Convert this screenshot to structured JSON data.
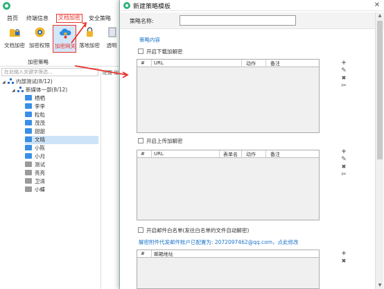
{
  "app": {
    "menu": [
      {
        "label": "首页"
      },
      {
        "label": "终端信息"
      },
      {
        "label": "文档加密"
      },
      {
        "label": "安全策略"
      }
    ],
    "ribbon": [
      {
        "label": "文档加密",
        "icon": "folder-lock-icon"
      },
      {
        "label": "加密权限",
        "icon": "gear-shield-icon"
      },
      {
        "label": "加密网关",
        "icon": "cloud-lock-icon"
      },
      {
        "label": "落地加密",
        "icon": "lock-icon"
      },
      {
        "label": "透明",
        "icon": "doc-icon"
      }
    ],
    "ribbon_group": "加密策略",
    "search_placeholder": "在此输入关键字筛选...",
    "right_tab": "配置 加",
    "tree": [
      {
        "label": "内部测试(8/12)",
        "type": "group"
      },
      {
        "label": "新媒体一部(8/12)",
        "type": "group"
      },
      {
        "label": "栖栖",
        "type": "pc"
      },
      {
        "label": "李李",
        "type": "pc"
      },
      {
        "label": "粒粒",
        "type": "pc"
      },
      {
        "label": "茂茂",
        "type": "pc"
      },
      {
        "label": "甜甜",
        "type": "pc"
      },
      {
        "label": "文晴",
        "type": "pc"
      },
      {
        "label": "小陈",
        "type": "pc"
      },
      {
        "label": "小月",
        "type": "pc"
      },
      {
        "label": "测试",
        "type": "pc"
      },
      {
        "label": "亮亮",
        "type": "pc"
      },
      {
        "label": "卫清",
        "type": "pc"
      },
      {
        "label": "小蝶",
        "type": "pc"
      }
    ]
  },
  "dialog": {
    "title": "新建策略模板",
    "close": "✕",
    "name_label": "策略名称:",
    "name_value": "",
    "content_heading": "策略内容",
    "download": {
      "check_label": "开启下载加解密",
      "columns": [
        "#",
        "URL",
        "动作",
        "备注"
      ]
    },
    "upload": {
      "check_label": "开启上传加解密",
      "columns": [
        "#",
        "URL",
        "表单名",
        "动作",
        "备注"
      ]
    },
    "mail": {
      "check_label": "开启邮件白名单(发往白名单的文件自动解密)",
      "note": "解密附件代发邮件账户已配置为: 2072097462@qq.com，点此修改",
      "columns": [
        "#",
        "邮箱地址"
      ]
    },
    "tools": {
      "add": "+",
      "edit": "✎",
      "delete": "✖",
      "clear": "✂"
    }
  },
  "colors": {
    "accent_red": "#e8322a",
    "link_blue": "#1a73c9",
    "brand_green": "#2fb37a"
  }
}
